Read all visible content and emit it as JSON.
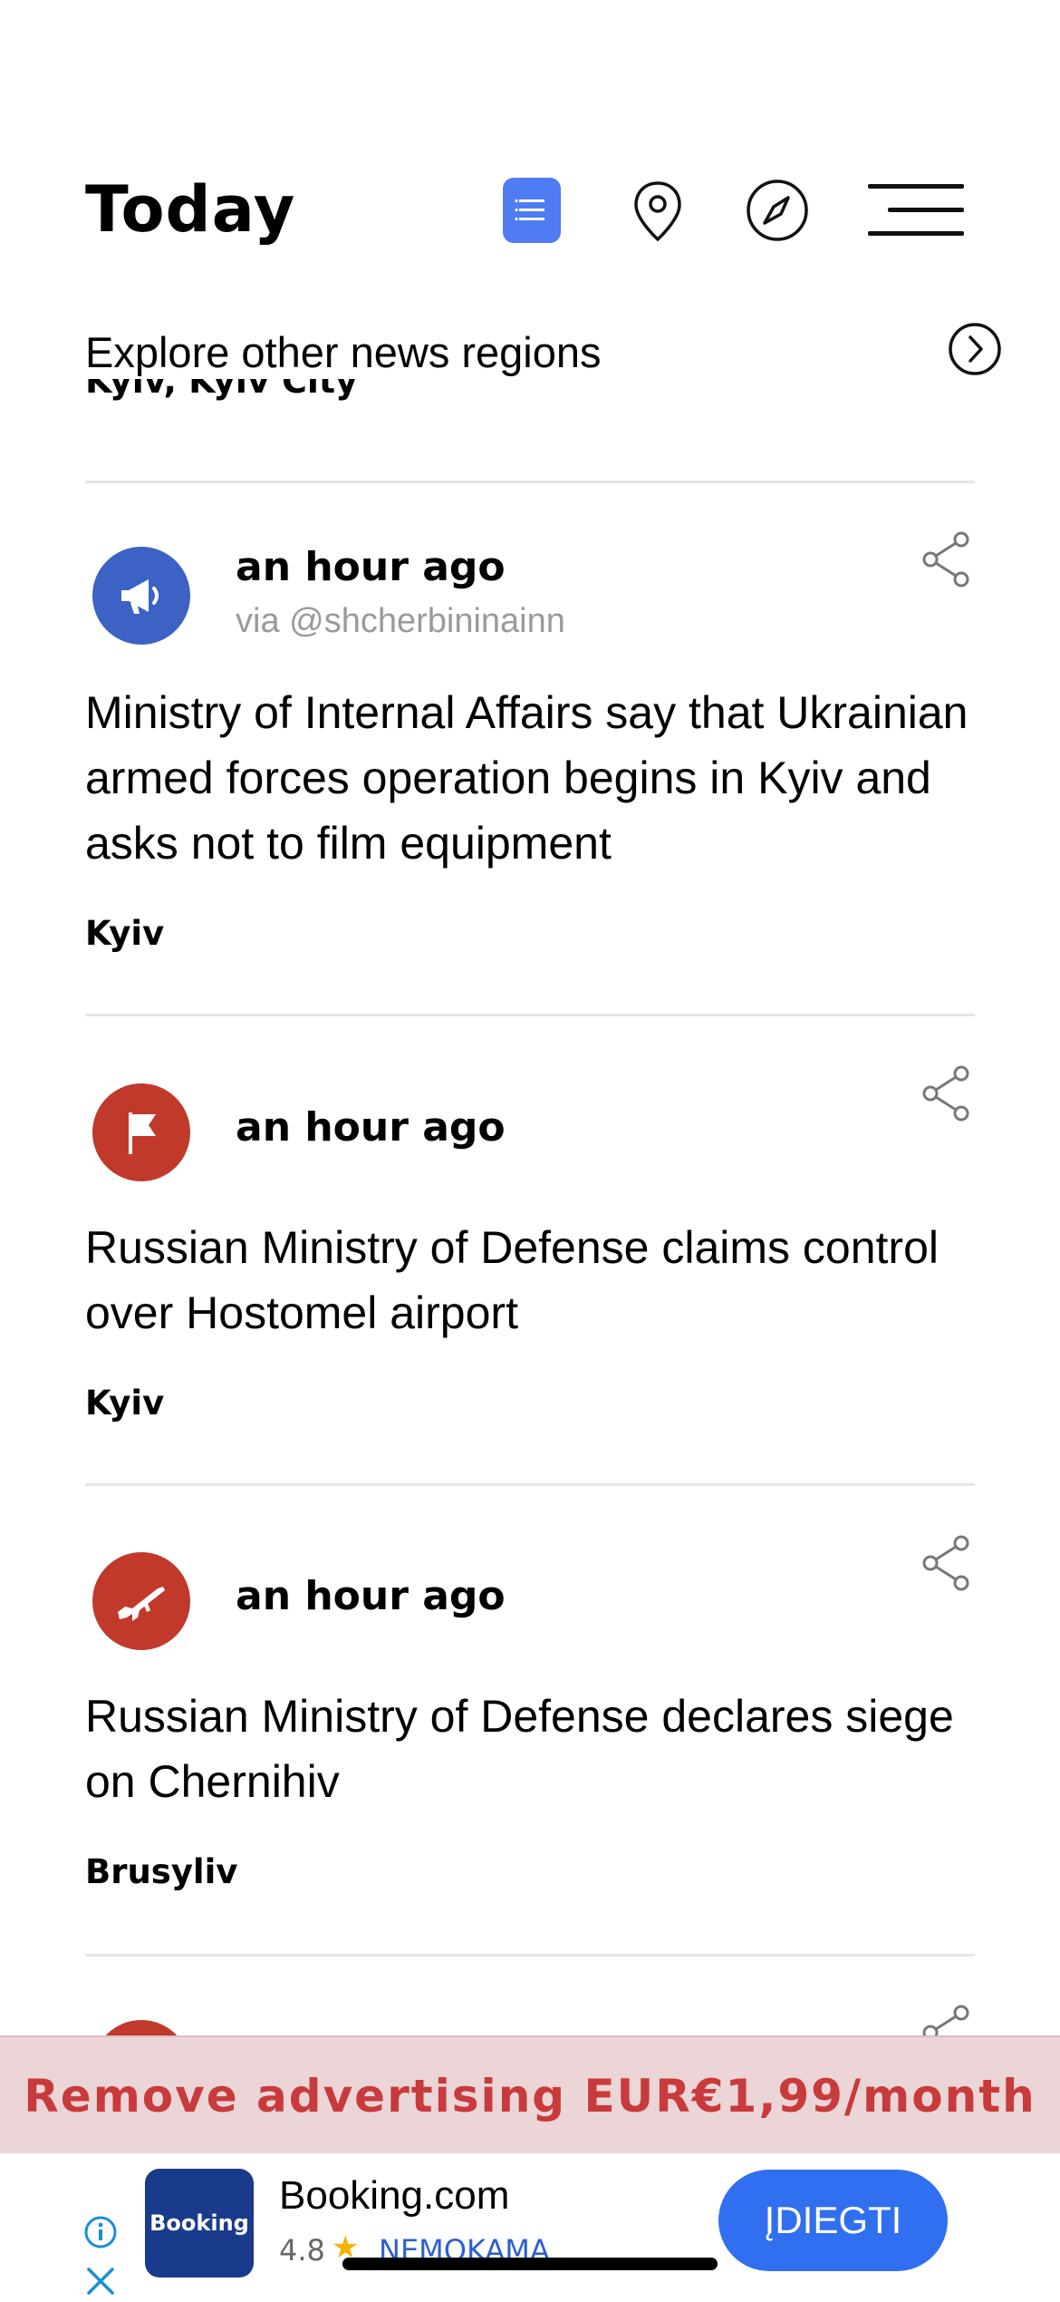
{
  "header": {
    "title": "Today",
    "icons": [
      "feed-icon",
      "map-pin-icon",
      "compass-icon",
      "menu-icon"
    ]
  },
  "explore": {
    "label": "Explore other news regions",
    "icon": "chevron-right-circle-icon"
  },
  "cut_off_location": "Kyiv, Kyiv City",
  "feed": [
    {
      "time": "an hour ago",
      "via": "via @shcherbininainn",
      "icon": "megaphone-icon",
      "avatar_color": "#3b62c4",
      "headline": "Ministry of Internal Affairs say that Ukrainian armed forces operation begins in Kyiv and asks not to film equipment",
      "location": "Kyiv"
    },
    {
      "time": "an hour ago",
      "icon": "flag-icon",
      "avatar_color": "#c0392b",
      "headline": "Russian Ministry of Defense claims control over Hostomel airport",
      "location": "Kyiv"
    },
    {
      "time": "an hour ago",
      "icon": "rifle-icon",
      "avatar_color": "#c0392b",
      "headline": "Russian Ministry of Defense declares siege on Chernihiv",
      "location": "Brusyliv"
    }
  ],
  "remove_ads": {
    "label": "Remove advertising EUR€1,99/month",
    "color": "#c93a3a"
  },
  "ad": {
    "logo_text": "Booking",
    "name": "Booking.com",
    "rating": "4.8",
    "price": "NEMOKAMA",
    "install_label": "ĮDIEGTI",
    "install_color": "#2f6ff0"
  }
}
